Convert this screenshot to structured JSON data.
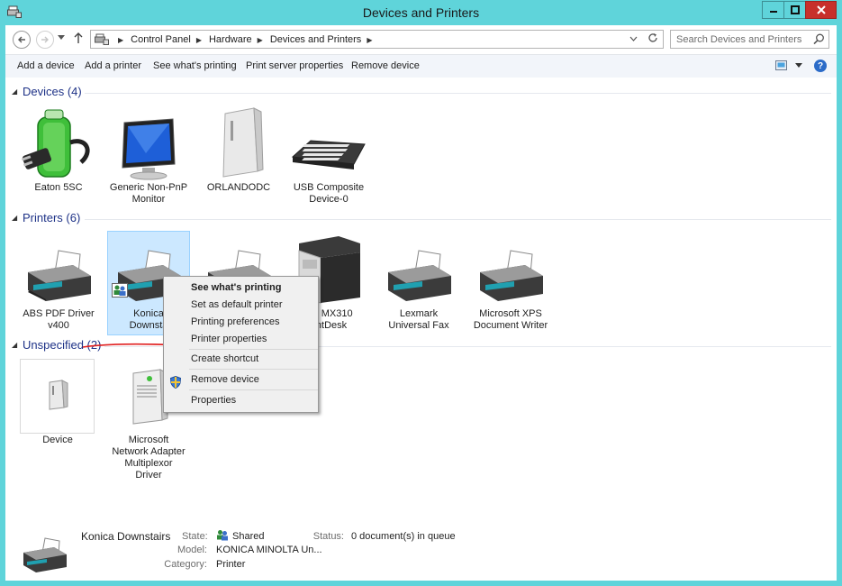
{
  "window": {
    "title": "Devices and Printers",
    "minimize_glyph": "—",
    "maximize_glyph": "□",
    "close_glyph": "✕"
  },
  "navigation": {
    "breadcrumbs": [
      "Control Panel",
      "Hardware",
      "Devices and Printers"
    ],
    "search_placeholder": "Search Devices and Printers"
  },
  "toolbar": {
    "add_device": "Add a device",
    "add_printer": "Add a printer",
    "see_printing": "See what's printing",
    "print_server": "Print server properties",
    "remove_device": "Remove device",
    "help_glyph": "?"
  },
  "groups": {
    "devices": {
      "title": "Devices (4)",
      "items": [
        {
          "label": "Eaton 5SC",
          "icon": "ups-battery-icon"
        },
        {
          "label": "Generic Non-PnP\nMonitor",
          "icon": "monitor-icon"
        },
        {
          "label": "ORLANDODC",
          "icon": "server-tower-icon"
        },
        {
          "label": "USB Composite\nDevice-0",
          "icon": "keyboard-icon"
        }
      ]
    },
    "printers": {
      "title": "Printers (6)",
      "items": [
        {
          "label": "ABS PDF Driver\nv400",
          "icon": "printer-icon"
        },
        {
          "label": "Konica\nDownsta",
          "icon": "printer-icon"
        },
        {
          "label": "",
          "icon": "printer-icon"
        },
        {
          "label": "ark MX310\nontDesk",
          "icon": "multifunction-printer-icon"
        },
        {
          "label": "Lexmark\nUniversal Fax",
          "icon": "printer-icon"
        },
        {
          "label": "Microsoft XPS\nDocument Writer",
          "icon": "printer-icon"
        }
      ]
    },
    "unspecified": {
      "title": "Unspecified (2)",
      "items": [
        {
          "label": "Device",
          "icon": "generic-device-icon"
        },
        {
          "label": "Microsoft\nNetwork Adapter\nMultiplexor\nDriver",
          "icon": "server-tower-icon"
        }
      ]
    }
  },
  "context_menu": {
    "items": [
      "See what's printing",
      "Set as default printer",
      "Printing preferences",
      "Printer properties",
      "Create shortcut",
      "Remove device",
      "Properties"
    ]
  },
  "details": {
    "name": "Konica Downstairs",
    "state_label": "State:",
    "state_value": "Shared",
    "status_label": "Status:",
    "status_value": "0 document(s) in queue",
    "model_label": "Model:",
    "model_value": "KONICA MINOLTA Un...",
    "category_label": "Category:",
    "category_value": "Printer"
  },
  "colors": {
    "frame": "#5fd4da",
    "group_title": "#1e3287",
    "selection": "#cce8ff",
    "annotation_arrow": "#e02020"
  }
}
